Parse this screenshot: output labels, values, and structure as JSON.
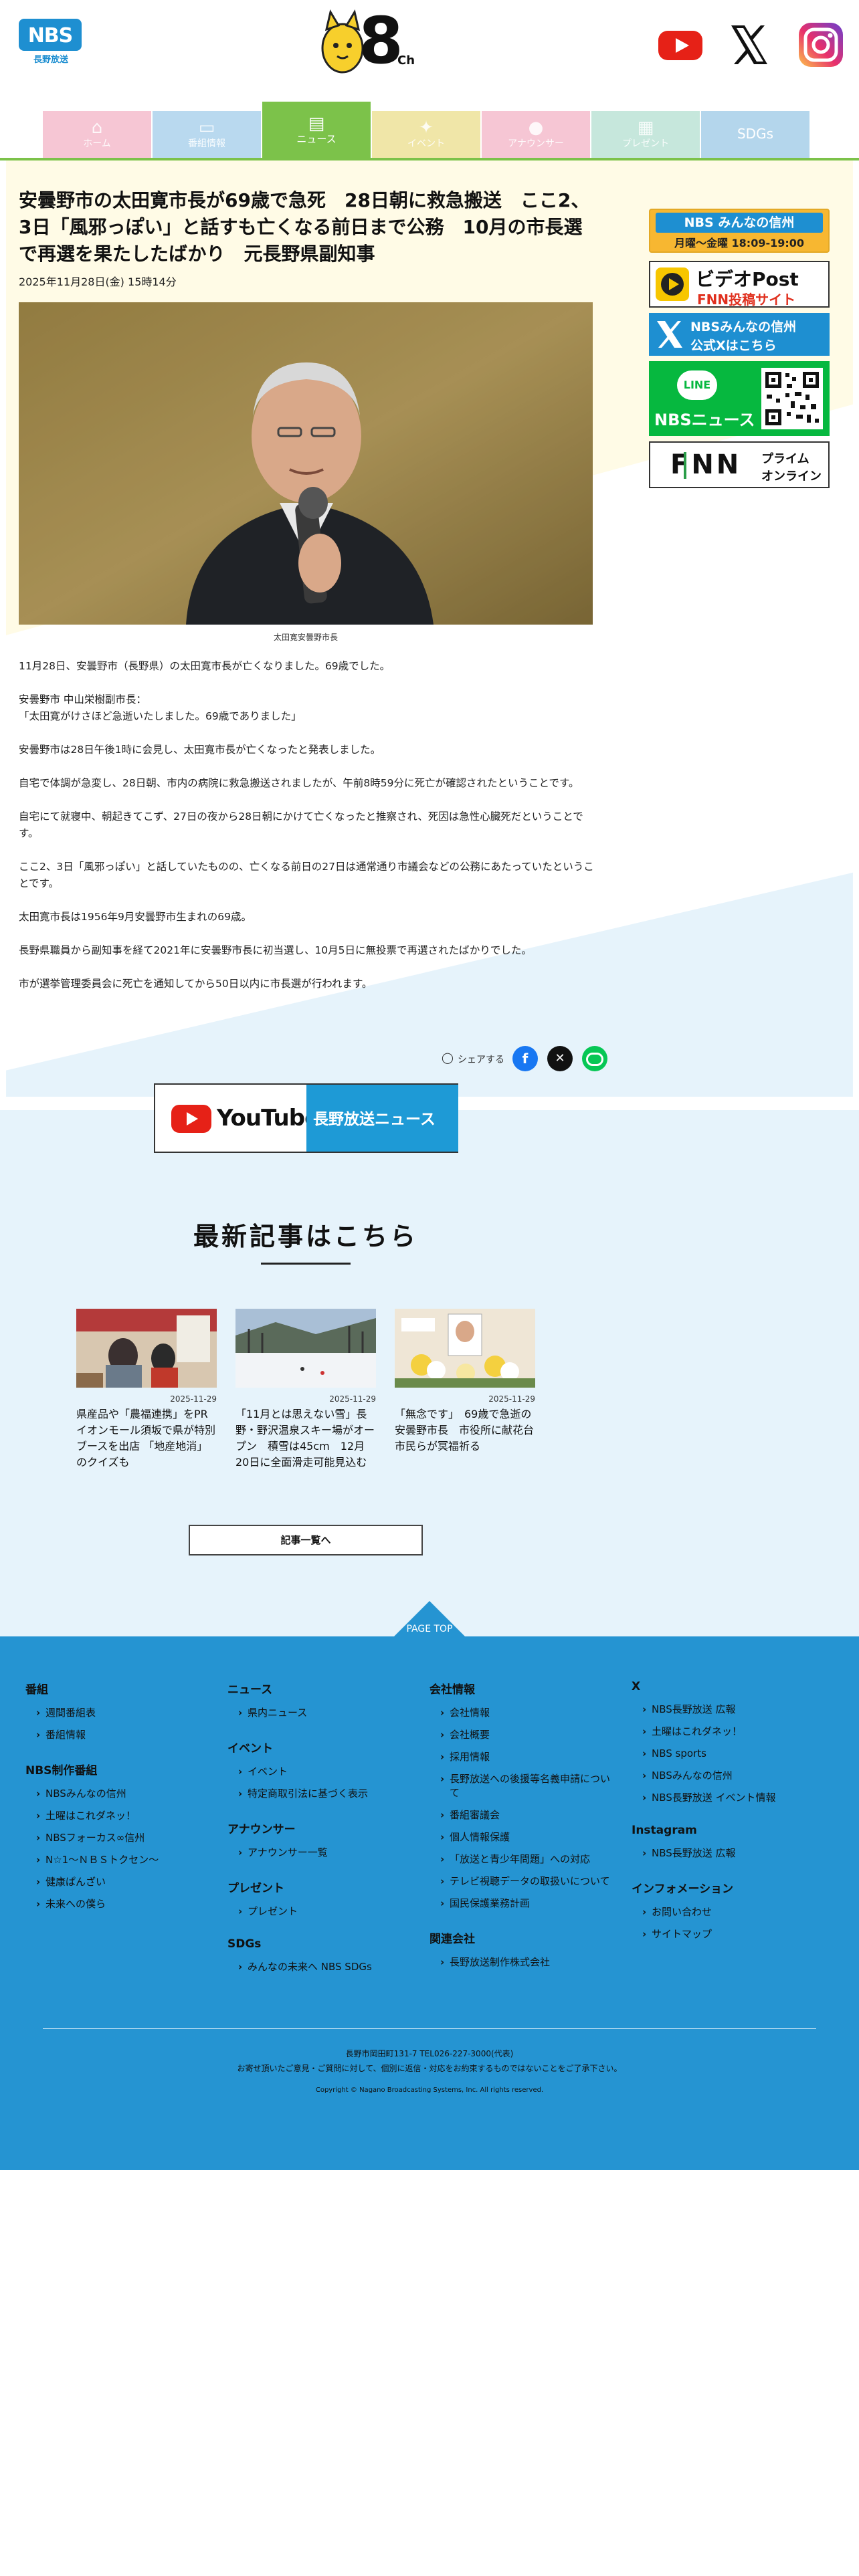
{
  "header": {
    "logo_text": "NBS",
    "logo_sub": "長野放送",
    "channel_text": "8",
    "channel_suffix": "Ch"
  },
  "nav": {
    "items": [
      {
        "label": "ホーム",
        "icon": "home-icon",
        "color": "#f6c6d4"
      },
      {
        "label": "番組情報",
        "icon": "tv-icon",
        "color": "#b9d9ef"
      },
      {
        "label": "ニュース",
        "icon": "news-icon",
        "color": "#7cc24a",
        "active": true
      },
      {
        "label": "イベント",
        "icon": "event-icon",
        "color": "#f0e6a8"
      },
      {
        "label": "アナウンサー",
        "icon": "mic-icon",
        "color": "#f6c6d4"
      },
      {
        "label": "プレゼント",
        "icon": "gift-icon",
        "color": "#c6e7dc"
      },
      {
        "label": "SDGs",
        "icon": "",
        "color": "#b4d6ec"
      }
    ]
  },
  "article": {
    "title": "安曇野市の太田寛市長が69歳で急死　28日朝に救急搬送　ここ2、3日「風邪っぽい」と話すも亡くなる前日まで公務　10月の市長選で再選を果たしたばかり　元長野県副知事",
    "date": "2025年11月28日(金) 15時14分",
    "photo_caption": "太田寛安曇野市長",
    "paragraphs": [
      "11月28日、安曇野市（長野県）の太田寛市長が亡くなりました。69歳でした。",
      "安曇野市 中山栄樹副市長：\n「太田寛がけさほど急逝いたしました。69歳でありました」",
      "安曇野市は28日午後1時に会見し、太田寛市長が亡くなったと発表しました。",
      "自宅で体調が急変し、28日朝、市内の病院に救急搬送されましたが、午前8時59分に死亡が確認されたということです。",
      "自宅にて就寝中、朝起きてこず、27日の夜から28日朝にかけて亡くなったと推察され、死因は急性心臓死だということです。",
      "ここ2、3日「風邪っぽい」と話していたものの、亡くなる前日の27日は通常通り市議会などの公務にあたっていたということです。",
      "太田寛市長は1956年9月安曇野市生まれの69歳。",
      "長野県職員から副知事を経て2021年に安曇野市長に初当選し、10月5日に無投票で再選されたばかりでした。",
      "市が選挙管理委員会に死亡を通知してから50日以内に市長選が行われます。"
    ]
  },
  "sidebar": {
    "banner1_main": "NBS みんなの信州",
    "banner1_sub": "月曜～金曜 18:09-19:00",
    "banner2_main": "ビデオPost",
    "banner2_sub": "FNN投稿サイト",
    "banner3_main": "NBSみんなの信州",
    "banner3_sub": "公式Xはこちら",
    "banner4_badge": "LINE",
    "banner4_main": "NBSニュース",
    "banner5_main": "FNN",
    "banner5_sub1": "プライム",
    "banner5_sub2": "オンライン"
  },
  "share": {
    "label": "シェアする"
  },
  "youtube_banner": {
    "brand": "YouTube",
    "channel": "長野放送ニュース"
  },
  "latest": {
    "title": "最新記事はこちら",
    "cards": [
      {
        "date": "2025-11-29",
        "title": "県産品や「農福連携」をPR　イオンモール須坂で県が特別ブースを出店 「地産地消」のクイズも"
      },
      {
        "date": "2025-11-29",
        "title": "「11月とは思えない雪」長野・野沢温泉スキー場がオープン　積雪は45cm　12月20日に全面滑走可能見込む"
      },
      {
        "date": "2025-11-29",
        "title": "「無念です」　69歳で急逝の安曇野市長　市役所に献花台　市民らが冥福祈る"
      }
    ],
    "more_label": "記事一覧へ"
  },
  "footer": {
    "pagetop": "PAGE TOP",
    "col1": [
      {
        "head": "番組",
        "items": [
          "週間番組表",
          "番組情報"
        ]
      },
      {
        "head": "NBS制作番組",
        "items": [
          "NBSみんなの信州",
          "土曜はこれダネッ！",
          "NBSフォーカス∞信州",
          "N☆1～ＮＢＳトクセン～",
          "健康ぱんざい",
          "未来への僕ら"
        ]
      }
    ],
    "col2": [
      {
        "head": "ニュース",
        "items": [
          "県内ニュース"
        ]
      },
      {
        "head": "イベント",
        "items": [
          "イベント",
          "特定商取引法に基づく表示"
        ]
      },
      {
        "head": "アナウンサー",
        "items": [
          "アナウンサー一覧"
        ]
      },
      {
        "head": "プレゼント",
        "items": [
          "プレゼント"
        ]
      },
      {
        "head": "SDGs",
        "items": [
          "みんなの未来へ NBS SDGs"
        ]
      }
    ],
    "col3": [
      {
        "head": "会社情報",
        "items": [
          "会社情報",
          "会社概要",
          "採用情報",
          "長野放送への後援等名義申請について",
          "番組審議会",
          "個人情報保護",
          "「放送と青少年問題」への対応",
          "テレビ視聴データの取扱いについて",
          "国民保護業務計画"
        ]
      },
      {
        "head": "関連会社",
        "items": [
          "長野放送制作株式会社"
        ]
      }
    ],
    "col4": [
      {
        "head": "X",
        "items": [
          "NBS長野放送 広報",
          "土曜はこれダネッ！",
          "NBS sports",
          "NBSみんなの信州",
          "NBS長野放送 イベント情報"
        ]
      },
      {
        "head": "Instagram",
        "items": [
          "NBS長野放送 広報"
        ]
      },
      {
        "head": "インフォメーション",
        "items": [
          "お問い合わせ",
          "サイトマップ"
        ]
      }
    ],
    "address": "長野市岡田町131-7 TEL026-227-3000(代表)",
    "notice": "お寄せ頂いたご意見・ご質問に対して、個別に返信・対応をお約束するものではないことをご了承下さい。",
    "copyright": "Copyright © Nagano Broadcasting Systems, Inc. All rights reserved."
  },
  "colors": {
    "accent_blue": "#2594d2",
    "nav_active": "#7cc24a",
    "bg_yellow": "#fffbe6",
    "bg_lightblue": "#e8f4fb"
  }
}
